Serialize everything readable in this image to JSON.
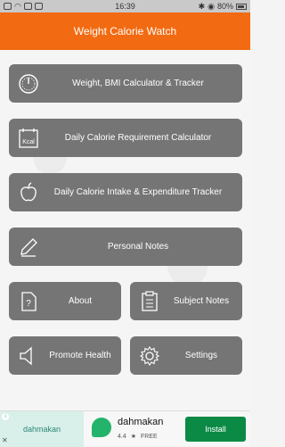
{
  "status_bar": {
    "time": "16:39",
    "battery": "80%"
  },
  "app": {
    "title": "Weight Calorie Watch"
  },
  "menu": {
    "weight_bmi": "Weight, BMI Calculator & Tracker",
    "calorie_requirement": "Daily Calorie Requirement Calculator",
    "calorie_intake": "Daily Calorie Intake & Expenditure Tracker",
    "personal_notes": "Personal Notes",
    "about": "About",
    "subject_notes": "Subject Notes",
    "promote_health": "Promote Health",
    "settings": "Settings"
  },
  "icons": {
    "kcal": "Kcal",
    "names": [
      "gauge-icon",
      "calendar-kcal-icon",
      "apple-icon",
      "pencil-icon",
      "question-document-icon",
      "clipboard-icon",
      "speaker-icon",
      "gear-icon"
    ]
  },
  "ad": {
    "thumb_text": "dahmakan",
    "app_name": "dahmakan",
    "rating": "4.4",
    "price": "FREE",
    "install_label": "Install"
  }
}
